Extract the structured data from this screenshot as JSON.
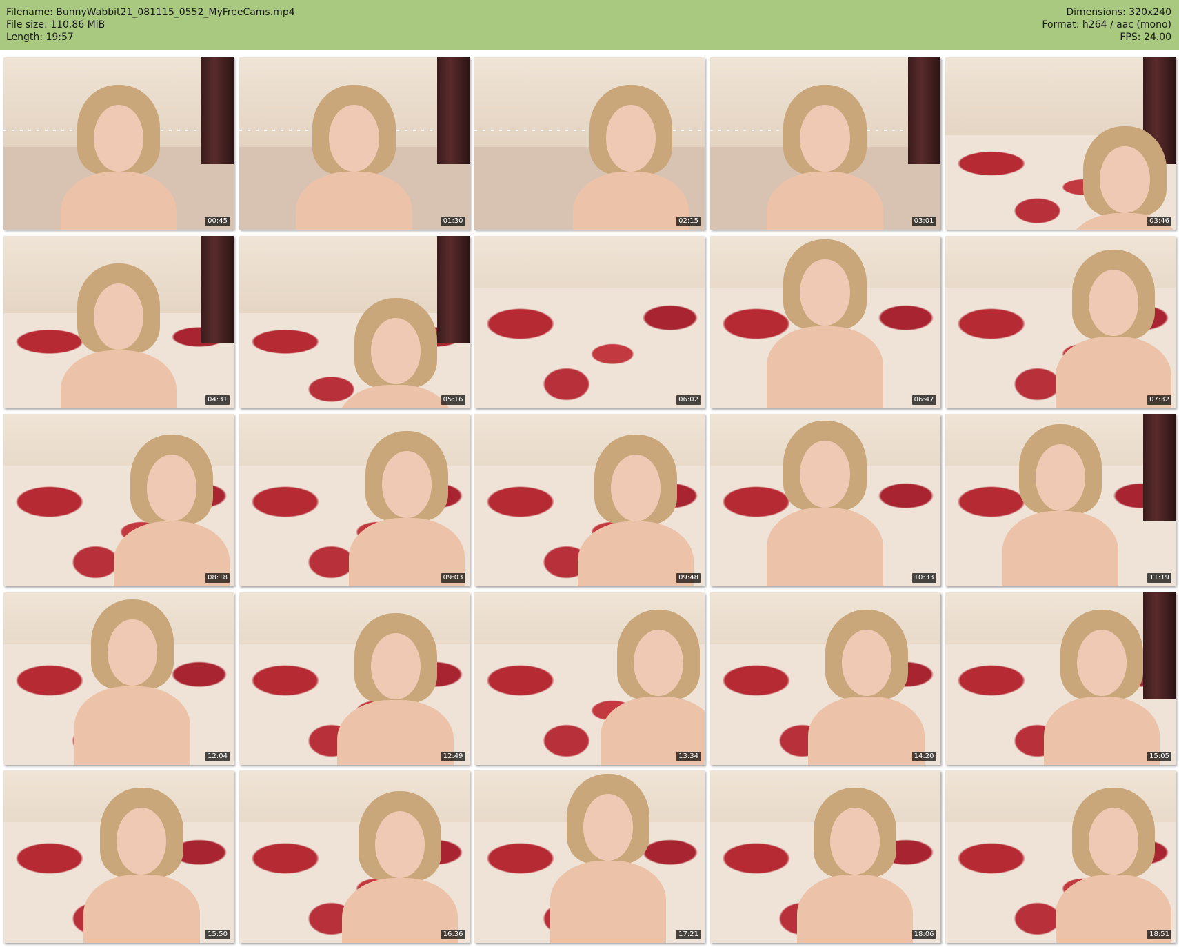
{
  "header": {
    "filename": "Filename: BunnyWabbit21_081115_0552_MyFreeCams.mp4",
    "file_size": "File size: 110.86 MiB",
    "length": "Length: 19:57",
    "dimensions": "Dimensions: 320x240",
    "format": "Format: h264 / aac (mono)",
    "fps": "FPS: 24.00"
  },
  "thumbnails": [
    {
      "timestamp": "00:45"
    },
    {
      "timestamp": "01:30"
    },
    {
      "timestamp": "02:15"
    },
    {
      "timestamp": "03:01"
    },
    {
      "timestamp": "03:46"
    },
    {
      "timestamp": "04:31"
    },
    {
      "timestamp": "05:16"
    },
    {
      "timestamp": "06:02"
    },
    {
      "timestamp": "06:47"
    },
    {
      "timestamp": "07:32"
    },
    {
      "timestamp": "08:18"
    },
    {
      "timestamp": "09:03"
    },
    {
      "timestamp": "09:48"
    },
    {
      "timestamp": "10:33"
    },
    {
      "timestamp": "11:19"
    },
    {
      "timestamp": "12:04"
    },
    {
      "timestamp": "12:49"
    },
    {
      "timestamp": "13:34"
    },
    {
      "timestamp": "14:20"
    },
    {
      "timestamp": "15:05"
    },
    {
      "timestamp": "15:50"
    },
    {
      "timestamp": "16:36"
    },
    {
      "timestamp": "17:21"
    },
    {
      "timestamp": "18:06"
    },
    {
      "timestamp": "18:51"
    }
  ]
}
